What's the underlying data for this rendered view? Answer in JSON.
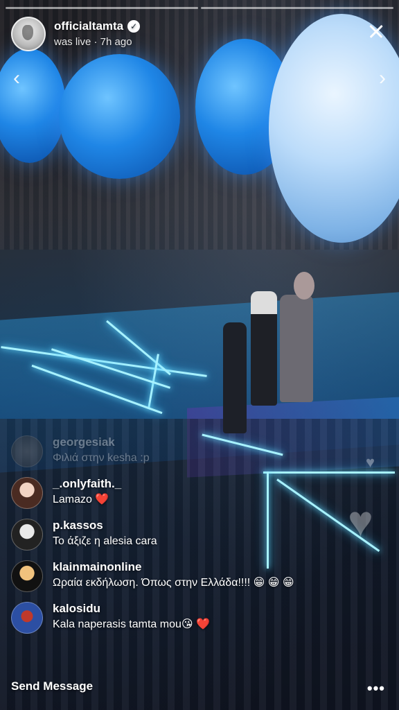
{
  "header": {
    "username": "officialtamta",
    "verified_icon": "verified-badge-icon",
    "status": "was live · 7h ago"
  },
  "navigation": {
    "prev_label": "‹",
    "next_label": "›",
    "close_icon": "close-icon"
  },
  "comments": [
    {
      "user": "georgesiak",
      "text": "Φιλιά στην kesha :p",
      "faded": true
    },
    {
      "user": "_.onlyfaith._",
      "text": "Lamazo ❤️"
    },
    {
      "user": "p.kassos",
      "text": "Το άξιζε η alesia cara"
    },
    {
      "user": "klainmainonline",
      "text": "Ωραία εκδήλωση. Όπως στην Ελλάδα!!!! 😁 😁 😁"
    },
    {
      "user": "kalosidu",
      "text": "Kala naperasis tamta mou😘 ❤️"
    }
  ],
  "bottom_bar": {
    "send_label": "Send Message",
    "more_label": "•••"
  },
  "colors": {
    "neon": "#a8f2ff",
    "balloon": "#1f86e6"
  }
}
